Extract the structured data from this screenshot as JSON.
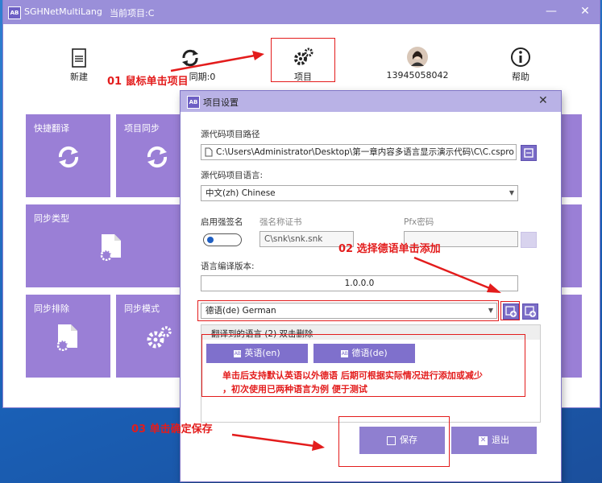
{
  "main": {
    "app_title": "SGHNetMultiLang",
    "current_project": "当前项目:C",
    "toolbar": {
      "new_label": "新建",
      "sync_label": "同期:0",
      "project_label": "项目",
      "user_label": "13945058042",
      "help_label": "帮助"
    },
    "tiles": {
      "quick_translate": "快捷翻译",
      "project_sync": "项目同步",
      "sync_type": "同步类型",
      "sync_exclude": "同步排除",
      "sync_mode": "同步模式"
    }
  },
  "dialog": {
    "title": "项目设置",
    "source_path_label": "源代码项目路径",
    "source_path_value": "C:\\Users\\Administrator\\Desktop\\第一章内容多语言显示演示代码\\C\\C.cspro",
    "source_lang_label": "源代码项目语言:",
    "source_lang_value": "中文(zh) Chinese",
    "strong_name_label": "启用强签名",
    "strong_cert_label": "强名称证书",
    "strong_cert_value": "C\\snk\\snk.snk",
    "pfx_label": "Pfx密码",
    "pfx_value": "",
    "version_label": "语言编译版本:",
    "version_value": "1.0.0.0",
    "lang_select_value": "德语(de) German",
    "translated_header": "翻译到的语言 (2) 双击删除",
    "languages": [
      "英语(en)",
      "德语(de)"
    ],
    "save_label": "保存",
    "exit_label": "退出"
  },
  "annotations": {
    "step1": "01 鼠标单击项目",
    "step2": "02 选择德语单击添加",
    "step3": "03 单击确定保存",
    "note_line1": "单击后支持默认英语以外德语 后期可根据实际情况进行添加或减少",
    "note_line2": "，初次使用已两种语言为例 便于测试"
  },
  "colors": {
    "accent": "#9a7fd6",
    "titlebar": "#9a8fd9",
    "annotation": "#e31c1c"
  }
}
